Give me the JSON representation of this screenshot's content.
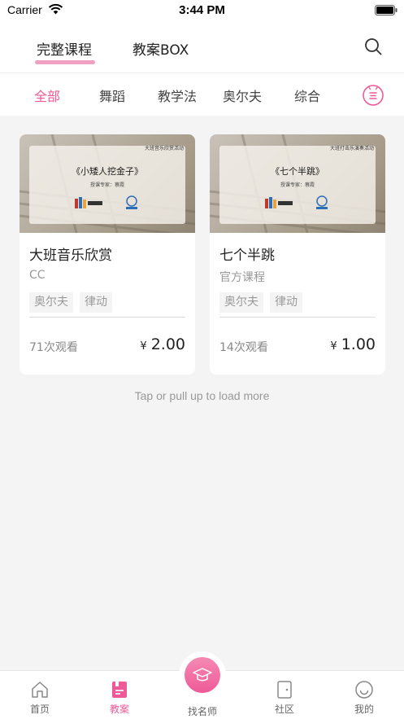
{
  "status": {
    "carrier": "Carrier",
    "time": "3:44 PM"
  },
  "header": {
    "tabs": [
      {
        "label": "完整课程",
        "active": true
      },
      {
        "label": "教案BOX",
        "active": false
      }
    ]
  },
  "categories": [
    {
      "label": "全部",
      "active": true
    },
    {
      "label": "舞蹈",
      "active": false
    },
    {
      "label": "教学法",
      "active": false
    },
    {
      "label": "奥尔夫",
      "active": false
    },
    {
      "label": "综合",
      "active": false
    }
  ],
  "accent_color": "#ee5a97",
  "courses": [
    {
      "thumb_event": "大班音乐欣赏活动",
      "thumb_title": "《小矮人挖金子》",
      "thumb_expert": "授课专家：蔡霞",
      "title": "大班音乐欣赏",
      "author": "CC",
      "tags": [
        "奥尔夫",
        "律动"
      ],
      "views": "71次观看",
      "currency": "¥",
      "price": "2.00"
    },
    {
      "thumb_event": "大班打击乐演奏活动",
      "thumb_title": "《七个半跳》",
      "thumb_expert": "授课专家：蔡霞",
      "title": "七个半跳",
      "author": "官方课程",
      "tags": [
        "奥尔夫",
        "律动"
      ],
      "views": "14次观看",
      "currency": "¥",
      "price": "1.00"
    }
  ],
  "load_more": "Tap or pull up to load more",
  "tabbar": {
    "items": [
      {
        "label": "首页",
        "icon": "home-icon",
        "active": false
      },
      {
        "label": "教案",
        "icon": "lesson-plan-icon",
        "active": true
      },
      {
        "label": "找名师",
        "icon": "graduation-cap-icon",
        "active": false
      },
      {
        "label": "社区",
        "icon": "community-icon",
        "active": false
      },
      {
        "label": "我的",
        "icon": "profile-icon",
        "active": false
      }
    ]
  }
}
